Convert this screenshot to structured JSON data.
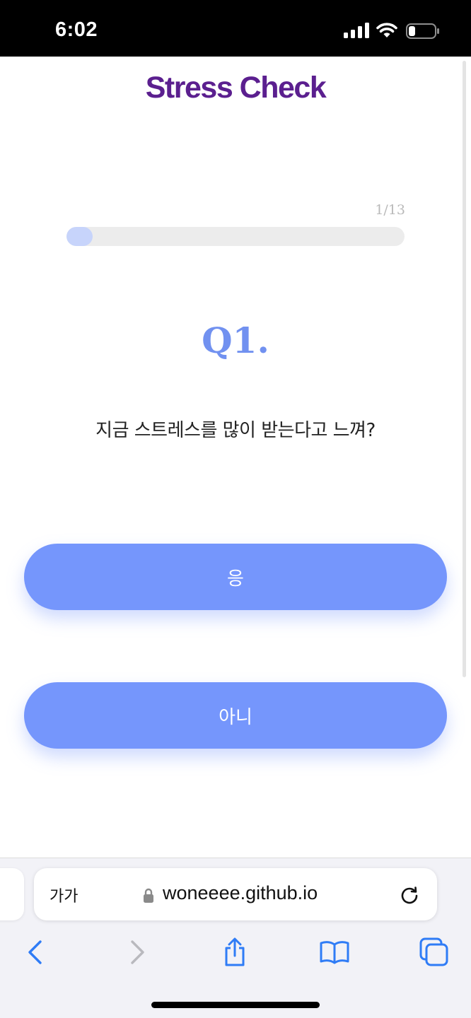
{
  "status_bar": {
    "time": "6:02",
    "signal_icon": "cellular-signal-icon",
    "wifi_icon": "wifi-icon",
    "battery_icon": "battery-low-icon"
  },
  "app": {
    "title": "Stress Check",
    "title_color": "#5b1f8f",
    "accent_color": "#7596fc"
  },
  "progress": {
    "label": "1/13",
    "current": 1,
    "total": 13
  },
  "question": {
    "number": "Q1.",
    "text": "지금 스트레스를 많이 받는다고 느껴?"
  },
  "answers": {
    "yes_label": "응",
    "no_label": "아니"
  },
  "browser": {
    "text_size_label": "가가",
    "url": "woneeee.github.io",
    "lock_icon": "lock-icon",
    "reload_icon": "reload-icon",
    "toolbar_icons": [
      "back-icon",
      "forward-icon",
      "share-icon",
      "bookmarks-icon",
      "tabs-icon"
    ]
  }
}
